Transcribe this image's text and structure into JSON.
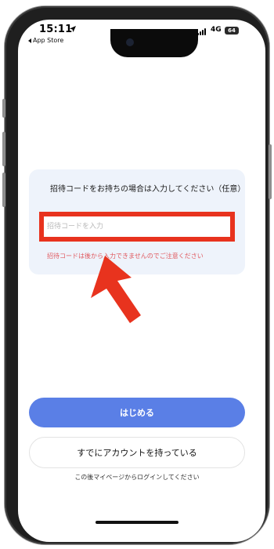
{
  "status_bar": {
    "time": "15:11",
    "back_app_label": "App Store",
    "network": "4G",
    "battery": "64"
  },
  "invite": {
    "title": "招待コードをお持ちの場合は入力してください（任意）",
    "placeholder": "招待コードを入力",
    "value": "",
    "note": "招待コードは後から入力できませんのでご注意ください"
  },
  "actions": {
    "start_label": "はじめる",
    "have_account_label": "すでにアカウントを持っている",
    "login_hint": "この後マイページからログインしてください"
  },
  "colors": {
    "highlight": "#e8331e",
    "primary_button": "#5a7fe6",
    "note_text": "#e0595f",
    "card_background": "#eef3fb"
  }
}
